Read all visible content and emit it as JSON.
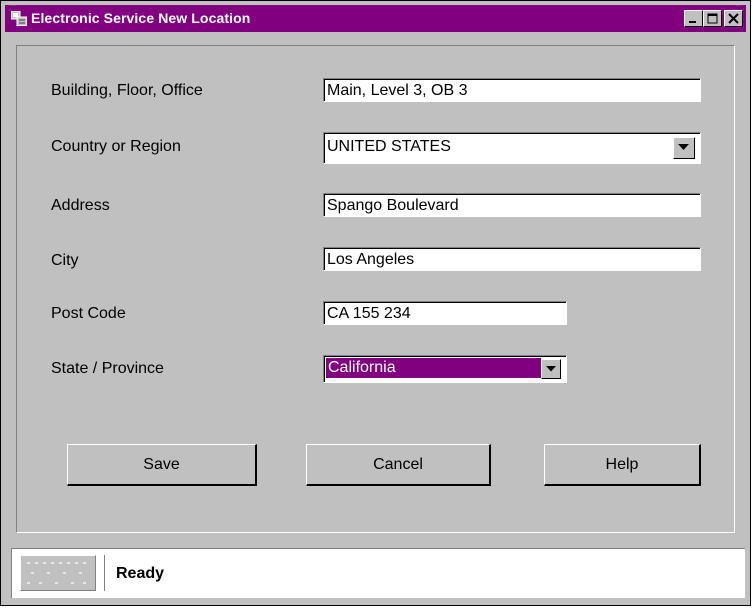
{
  "window": {
    "title": "Electronic Service New Location",
    "icon": "app-window-icon"
  },
  "titlebar_buttons": {
    "minimize": "minimize-icon",
    "maximize": "maximize-icon",
    "close": "close-icon"
  },
  "form": {
    "building": {
      "label": "Building, Floor, Office",
      "value": "Main, Level 3, OB 3"
    },
    "country": {
      "label": "Country or Region",
      "value": "UNITED STATES"
    },
    "address": {
      "label": "Address",
      "value": "Spango Boulevard"
    },
    "city": {
      "label": "City",
      "value": "Los Angeles"
    },
    "postcode": {
      "label": "Post Code",
      "value": "CA 155 234"
    },
    "state": {
      "label": "State / Province",
      "value": "California"
    }
  },
  "buttons": {
    "save": "Save",
    "cancel": "Cancel",
    "help": "Help"
  },
  "status": {
    "text": "Ready"
  },
  "colors": {
    "titlebar": "#800080",
    "face": "#c0c0c0",
    "selection": "#800080"
  }
}
